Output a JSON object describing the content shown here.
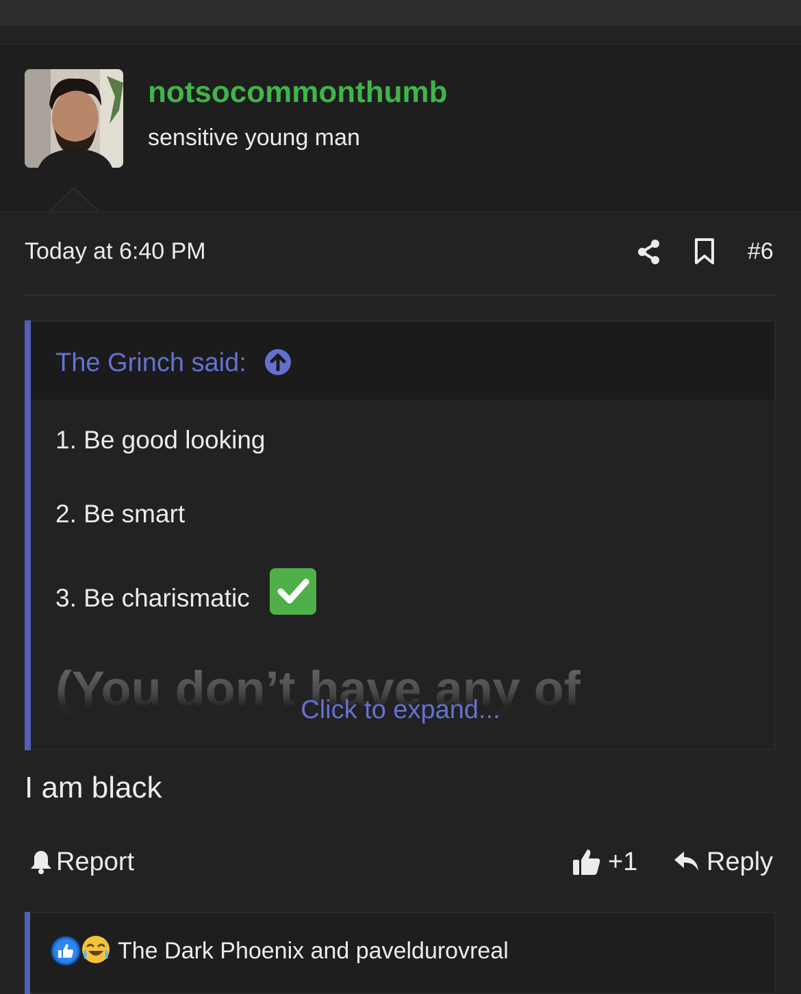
{
  "post": {
    "author": "notsocommonthumb",
    "author_title": "sensitive young man",
    "timestamp": "Today at 6:40 PM",
    "post_number": "#6",
    "body": "I am black"
  },
  "quote": {
    "attribution": "The Grinch said:",
    "lines": [
      "1. Be good looking",
      "2. Be smart",
      "3. Be charismatic"
    ],
    "faded_text": "(You don’t have any of",
    "expand_label": "Click to expand..."
  },
  "actions": {
    "report_label": "Report",
    "like_count": "+1",
    "reply_label": "Reply"
  },
  "reactions": {
    "icons": [
      "like-reaction-icon",
      "crying-laughing-reaction-icon"
    ],
    "text": "The Dark Phoenix and paveldurovreal"
  },
  "colors": {
    "username": "#3fb54a",
    "accent": "#6571d1",
    "quote_bar": "#5360b8",
    "background": "#222222"
  }
}
